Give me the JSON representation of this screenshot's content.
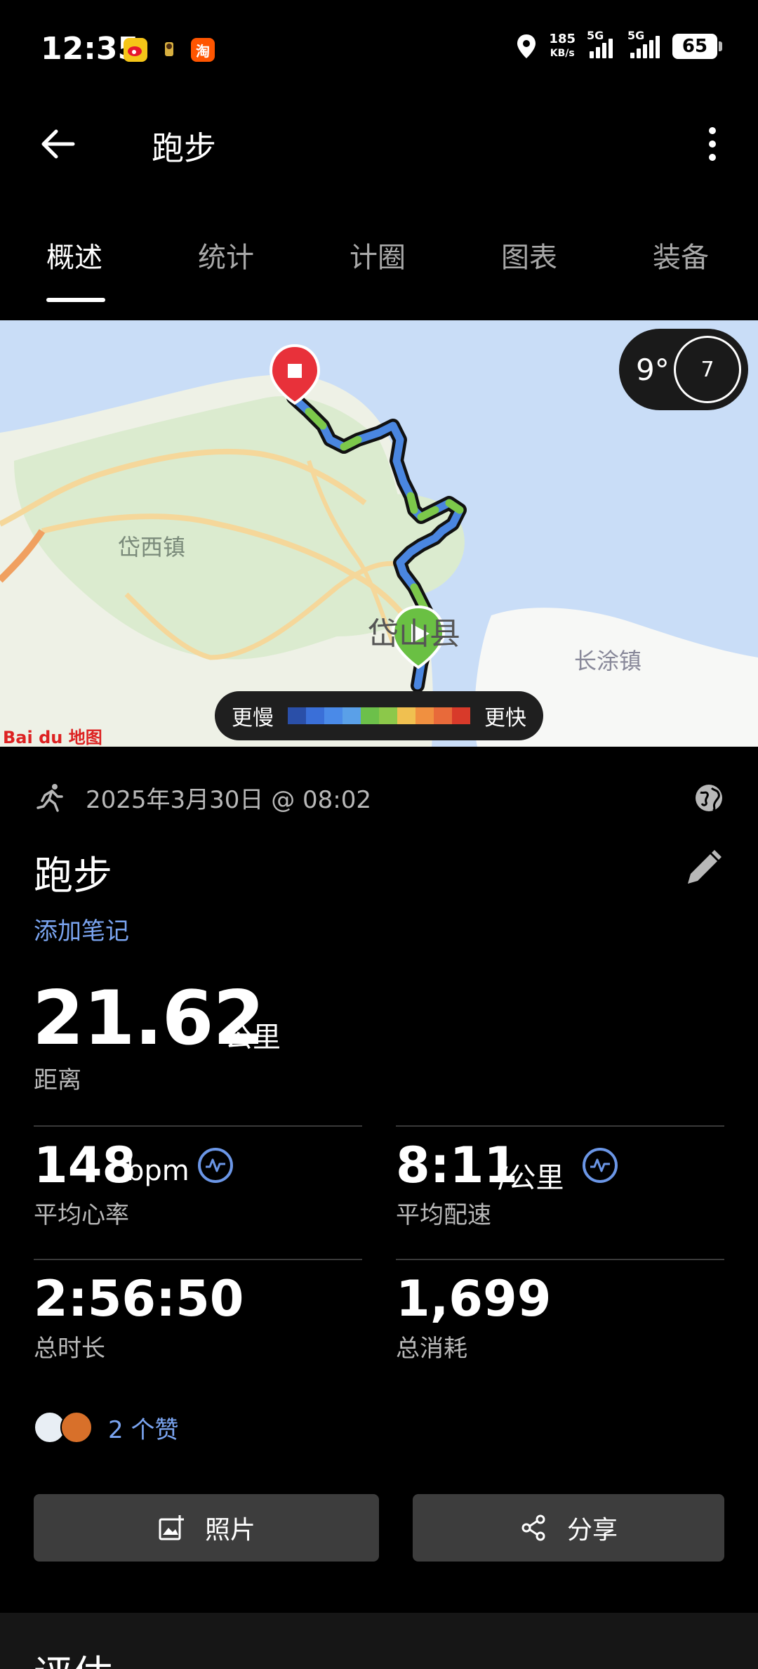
{
  "status_bar": {
    "time": "12:35",
    "apps": [
      "weibo-icon",
      "app-icon",
      "taobao-icon"
    ],
    "taobao_label": "淘",
    "net_speed_value": "185",
    "net_speed_unit": "KB/s",
    "sim1": "5G",
    "sim2": "5G",
    "battery": "65"
  },
  "app_bar": {
    "title": "跑步"
  },
  "tabs": [
    {
      "label": "概述",
      "active": true
    },
    {
      "label": "统计",
      "active": false
    },
    {
      "label": "计圈",
      "active": false
    },
    {
      "label": "图表",
      "active": false
    },
    {
      "label": "装备",
      "active": false
    }
  ],
  "map": {
    "weather_temp": "9°",
    "wind_speed": "7",
    "legend_slow": "更慢",
    "legend_fast": "更快",
    "legend_colors": [
      "#2a4fa8",
      "#3a6fd8",
      "#4a8ae8",
      "#5aa0e8",
      "#6cc04a",
      "#8cc84a",
      "#f0c050",
      "#f09040",
      "#e86a3a",
      "#d83a2a"
    ],
    "labels": {
      "town_west": "岱西镇",
      "county": "岱山县",
      "town_east": "长涂镇"
    },
    "provider": "Bai du 地图"
  },
  "activity": {
    "datetime": "2025年3月30日 @ 08:02",
    "title": "跑步",
    "add_note": "添加笔记",
    "distance_value": "21.62",
    "distance_unit": "公里",
    "distance_label": "距离",
    "stats": {
      "avg_hr_value": "148",
      "avg_hr_unit": "bpm",
      "avg_hr_label": "平均心率",
      "avg_pace_value": "8:11",
      "avg_pace_unit": "/公里",
      "avg_pace_label": "平均配速",
      "duration_value": "2:56:50",
      "duration_label": "总时长",
      "calories_value": "1,699",
      "calories_label": "总消耗"
    },
    "likes": "2 个赞"
  },
  "buttons": {
    "photos": "照片",
    "share": "分享"
  },
  "evaluation": {
    "title": "评估"
  }
}
